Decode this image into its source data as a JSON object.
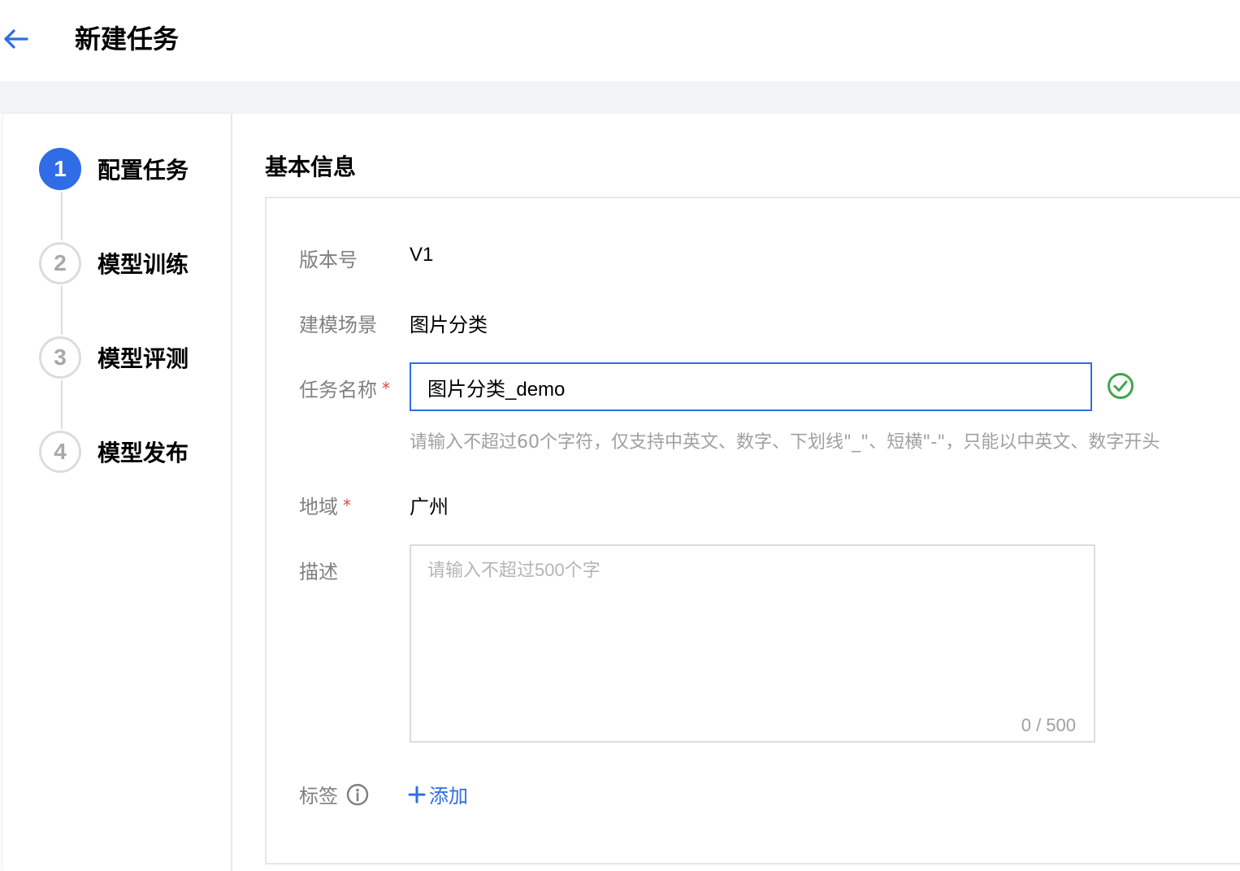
{
  "header": {
    "title": "新建任务",
    "back_icon": "arrow-left-icon"
  },
  "steps": [
    {
      "number": "1",
      "label": "配置任务",
      "status": "active"
    },
    {
      "number": "2",
      "label": "模型训练",
      "status": "pending"
    },
    {
      "number": "3",
      "label": "模型评测",
      "status": "pending"
    },
    {
      "number": "4",
      "label": "模型发布",
      "status": "pending"
    }
  ],
  "form": {
    "section_title": "基本信息",
    "version": {
      "label": "版本号",
      "value": "V1"
    },
    "scene": {
      "label": "建模场景",
      "value": "图片分类"
    },
    "task_name": {
      "label": "任务名称",
      "required_mark": "*",
      "value": "图片分类_demo",
      "valid_icon": "check-circle-icon",
      "hint": "请输入不超过60个字符，仅支持中英文、数字、下划线\"_\"、短横\"-\"，只能以中英文、数字开头"
    },
    "region": {
      "label": "地域",
      "required_mark": "*",
      "value": "广州"
    },
    "description": {
      "label": "描述",
      "placeholder": "请输入不超过500个字",
      "value": "",
      "counter": "0 / 500"
    },
    "tags": {
      "label": "标签",
      "info_icon": "info-circle-icon",
      "add_label": "添加"
    }
  },
  "colors": {
    "primary": "#2f6ce5",
    "success": "#3fa64b",
    "required": "#e54545",
    "band": "#f2f3f5"
  }
}
